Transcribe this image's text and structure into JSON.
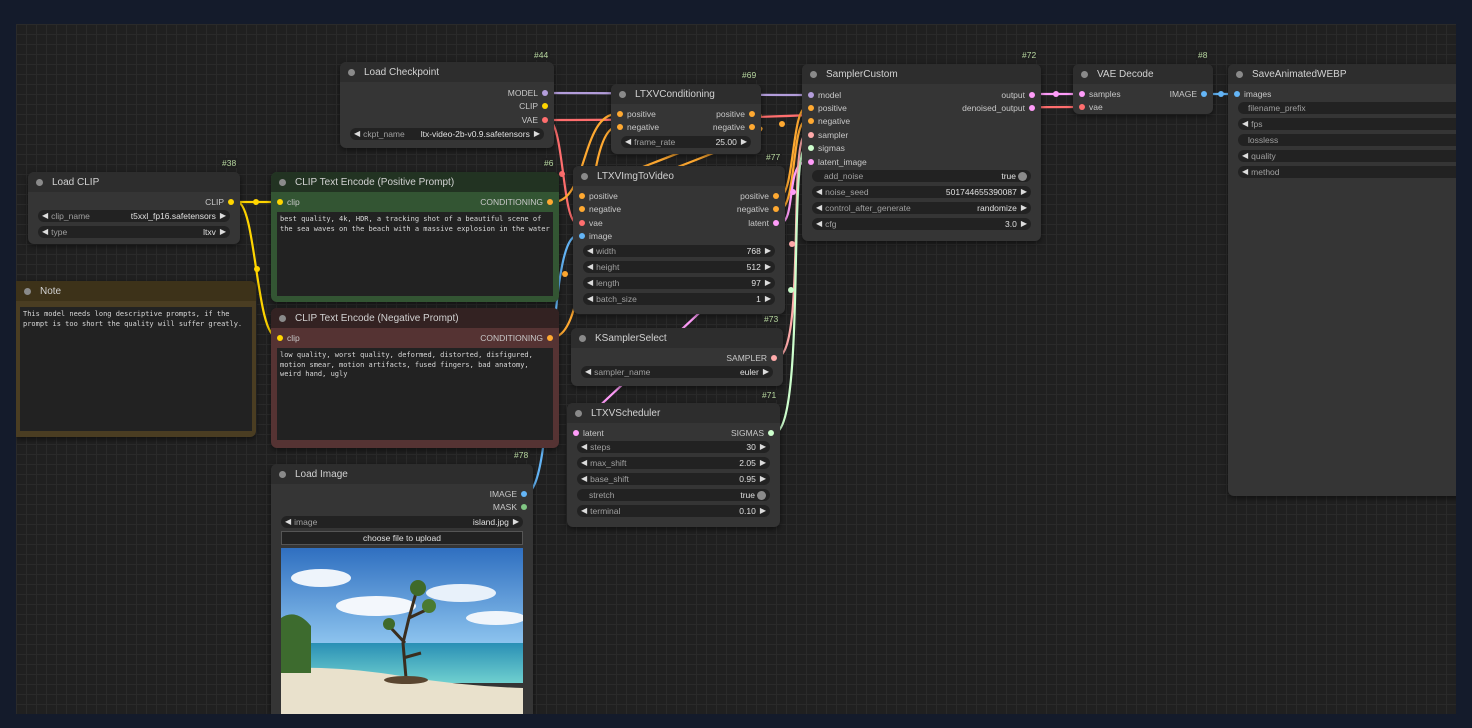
{
  "colors": {
    "model": "#b39ddb",
    "clip": "#ffd500",
    "vae": "#ff6e6e",
    "conditioning": "#ffa931",
    "image": "#64b5f6",
    "latent": "#ff9cf9",
    "sampler": "#ffaaaa",
    "sigmas": "#cdffcd",
    "mask": "#81c784"
  },
  "nodes": {
    "load_checkpoint": {
      "id": "#44",
      "title": "Load Checkpoint",
      "out_model": "MODEL",
      "out_clip": "CLIP",
      "out_vae": "VAE",
      "ckpt_label": "ckpt_name",
      "ckpt_value": "ltx-video-2b-v0.9.safetensors"
    },
    "load_clip": {
      "id": "#38",
      "title": "Load CLIP",
      "out_clip": "CLIP",
      "clip_name_label": "clip_name",
      "clip_name_value": "t5xxl_fp16.safetensors",
      "type_label": "type",
      "type_value": "ltxv"
    },
    "note": {
      "title": "Note",
      "text": "This model needs long descriptive prompts, if the prompt is too short the quality will suffer greatly."
    },
    "clip_pos": {
      "id": "#6",
      "title": "CLIP Text Encode (Positive Prompt)",
      "in_clip": "clip",
      "out_cond": "CONDITIONING",
      "text": "best quality, 4k, HDR, a tracking shot of a beautiful scene of the sea waves on the beach with a massive explosion in the water"
    },
    "clip_neg": {
      "title": "CLIP Text Encode (Negative Prompt)",
      "in_clip": "clip",
      "out_cond": "CONDITIONING",
      "text": "low quality, worst quality, deformed, distorted, disfigured, motion smear, motion artifacts, fused fingers, bad anatomy, weird hand, ugly"
    },
    "load_image": {
      "id": "#78",
      "title": "Load Image",
      "out_image": "IMAGE",
      "out_mask": "MASK",
      "image_label": "image",
      "image_value": "island.jpg",
      "upload_label": "choose file to upload"
    },
    "ltxv_cond": {
      "id": "#69",
      "title": "LTXVConditioning",
      "in_pos": "positive",
      "in_neg": "negative",
      "out_pos": "positive",
      "out_neg": "negative",
      "fr_label": "frame_rate",
      "fr_value": "25.00"
    },
    "ltxv_i2v": {
      "id": "#77",
      "title": "LTXVImgToVideo",
      "in_pos": "positive",
      "in_neg": "negative",
      "in_vae": "vae",
      "in_image": "image",
      "out_pos": "positive",
      "out_neg": "negative",
      "out_latent": "latent",
      "width_label": "width",
      "width_value": "768",
      "height_label": "height",
      "height_value": "512",
      "length_label": "length",
      "length_value": "97",
      "batch_label": "batch_size",
      "batch_value": "1"
    },
    "ksampler_select": {
      "id": "#73",
      "title": "KSamplerSelect",
      "out_sampler": "SAMPLER",
      "sampler_label": "sampler_name",
      "sampler_value": "euler"
    },
    "ltxv_scheduler": {
      "id": "#71",
      "title": "LTXVScheduler",
      "in_latent": "latent",
      "out_sigmas": "SIGMAS",
      "steps_label": "steps",
      "steps_value": "30",
      "max_shift_label": "max_shift",
      "max_shift_value": "2.05",
      "base_shift_label": "base_shift",
      "base_shift_value": "0.95",
      "stretch_label": "stretch",
      "stretch_value": "true",
      "terminal_label": "terminal",
      "terminal_value": "0.10"
    },
    "sampler_custom": {
      "id": "#72",
      "title": "SamplerCustom",
      "in_model": "model",
      "in_pos": "positive",
      "in_neg": "negative",
      "in_sampler": "sampler",
      "in_sigmas": "sigmas",
      "in_latent": "latent_image",
      "out_output": "output",
      "out_denoised": "denoised_output",
      "add_noise_label": "add_noise",
      "add_noise_value": "true",
      "seed_label": "noise_seed",
      "seed_value": "501744655390087",
      "cag_label": "control_after_generate",
      "cag_value": "randomize",
      "cfg_label": "cfg",
      "cfg_value": "3.0"
    },
    "vae_decode": {
      "id": "#8",
      "title": "VAE Decode",
      "in_samples": "samples",
      "in_vae": "vae",
      "out_image": "IMAGE"
    },
    "save_webp": {
      "title": "SaveAnimatedWEBP",
      "in_images": "images",
      "filename_label": "filename_prefix",
      "fps_label": "fps",
      "lossless_label": "lossless",
      "quality_label": "quality",
      "method_label": "method"
    }
  }
}
